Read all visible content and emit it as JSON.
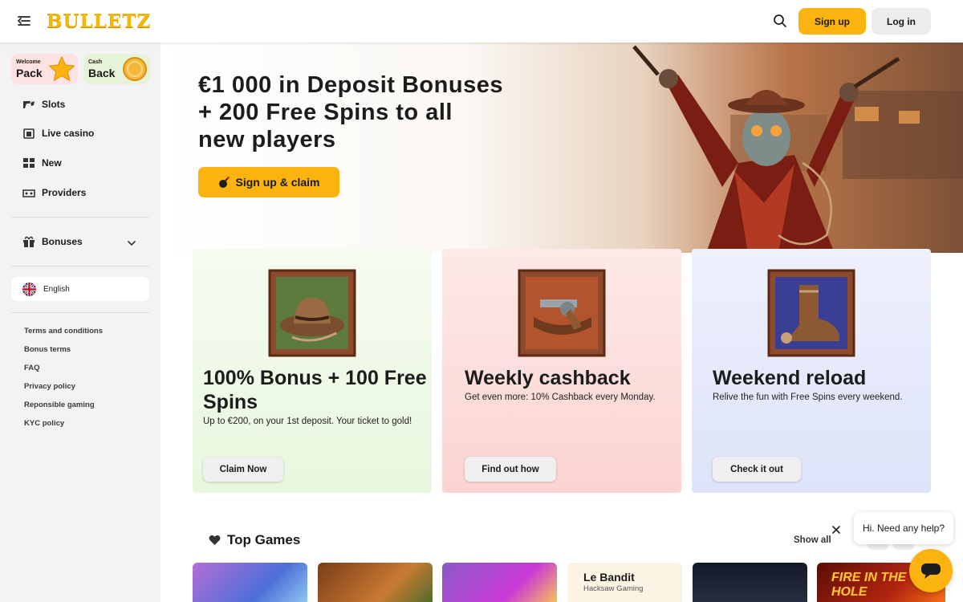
{
  "header": {
    "logo": "BULLETZ",
    "signup_label": "Sign up",
    "login_label": "Log in"
  },
  "sidebar": {
    "promos": [
      {
        "small": "Welcome",
        "big": "Pack"
      },
      {
        "small": "Cash",
        "big": "Back"
      }
    ],
    "nav": [
      {
        "label": "Slots",
        "icon": "slots-icon"
      },
      {
        "label": "Live casino",
        "icon": "live-casino-icon"
      },
      {
        "label": "New",
        "icon": "new-icon"
      },
      {
        "label": "Providers",
        "icon": "providers-icon"
      }
    ],
    "bonuses_label": "Bonuses",
    "language": "English",
    "footer_links": [
      "Terms and conditions",
      "Bonus terms",
      "FAQ",
      "Privacy policy",
      "Reponsible gaming",
      "KYC policy"
    ]
  },
  "hero": {
    "title": "€1 000 in Deposit Bonuses + 200 Free Spins to all new players",
    "cta_label": "Sign up & claim"
  },
  "cards": [
    {
      "title": "100% Bonus + 100 Free Spins",
      "desc": "Up to €200, on your 1st deposit. Your ticket to gold!",
      "button": "Claim Now",
      "icon": "cowboy-hat-icon"
    },
    {
      "title": "Weekly cashback",
      "desc": "Get even more: 10% Cashback every Monday.",
      "button": "Find out how",
      "icon": "revolver-icon"
    },
    {
      "title": "Weekend reload",
      "desc": "Relive the fun with Free Spins every weekend.",
      "button": "Check it out",
      "icon": "cowboy-boot-icon"
    }
  ],
  "top_games": {
    "title": "Top Games",
    "show_all": "Show all",
    "tiles": [
      {
        "title": "",
        "provider": ""
      },
      {
        "title": "",
        "provider": ""
      },
      {
        "title": "",
        "provider": ""
      },
      {
        "title": "Le Bandit",
        "provider": "Hacksaw Gaming"
      },
      {
        "title": "",
        "provider": ""
      },
      {
        "title": "FIRE IN THE HOLE",
        "provider": ""
      }
    ]
  },
  "chat": {
    "message": "Hi. Need any help?"
  },
  "colors": {
    "accent": "#fbb40f",
    "logo": "#f5b800"
  }
}
